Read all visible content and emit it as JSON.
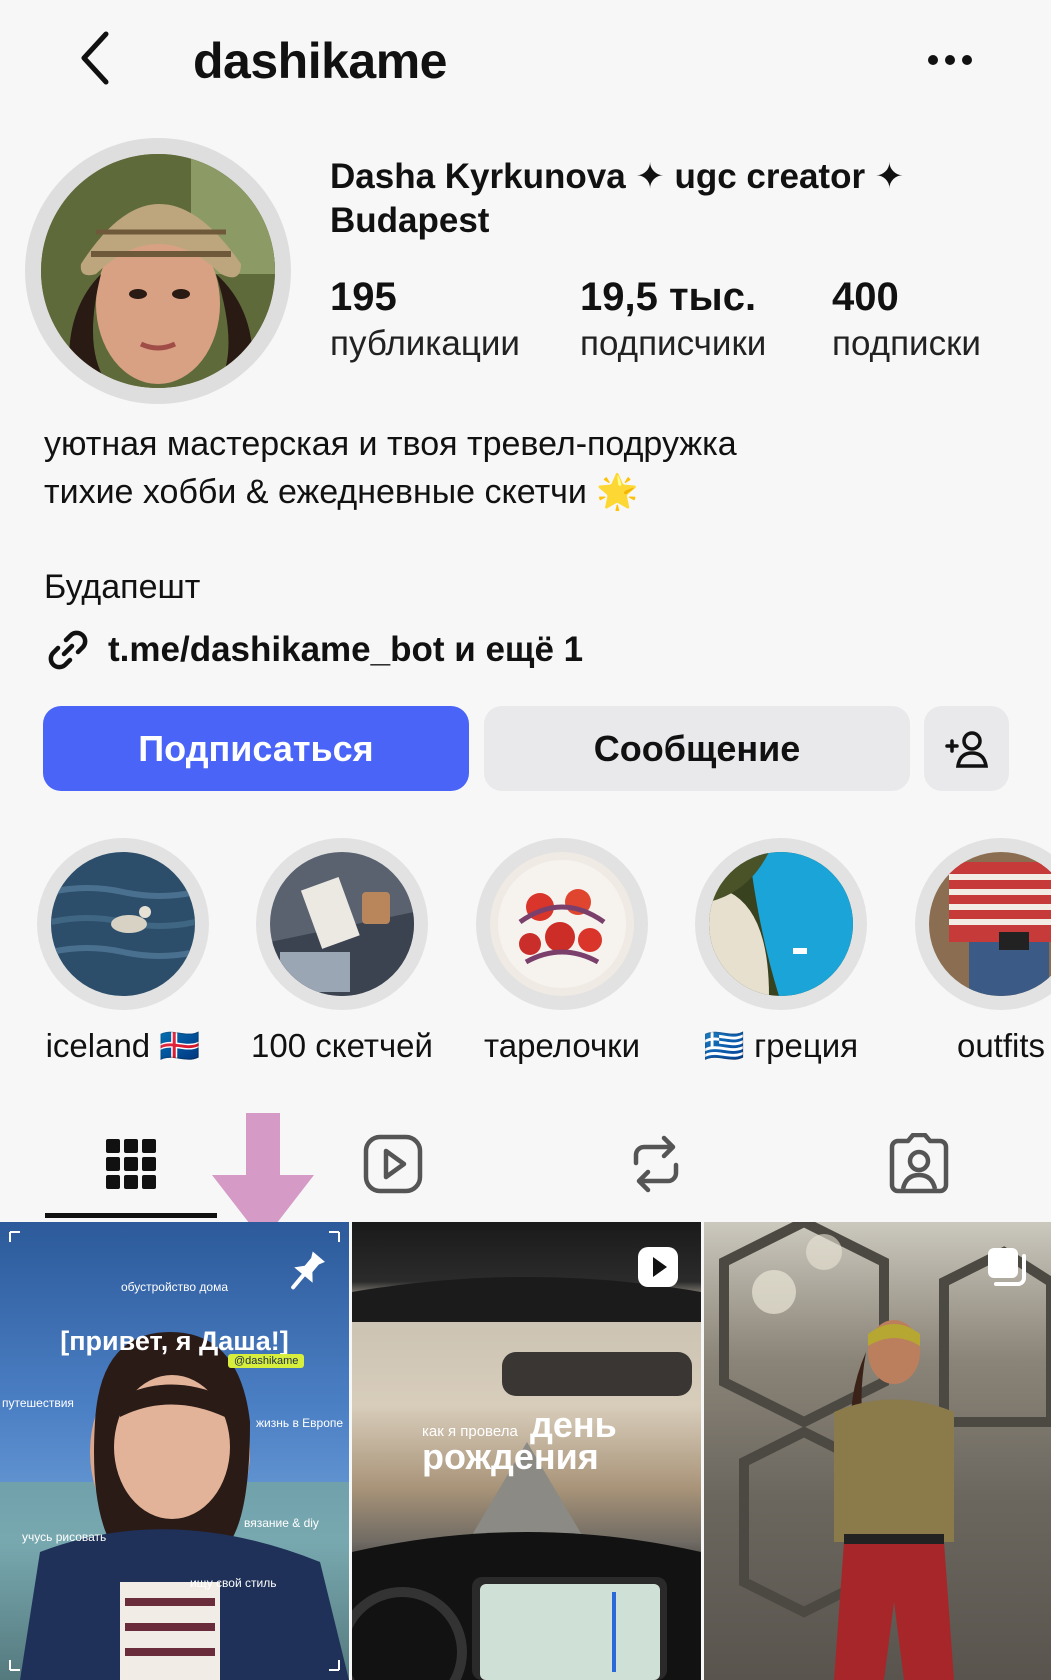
{
  "header": {
    "username": "dashikame"
  },
  "profile": {
    "display_name": "Dasha Kyrkunova ✦ ugc creator ✦ Budapest",
    "stats": [
      {
        "value": "195",
        "label": "публикации"
      },
      {
        "value": "19,5 тыс.",
        "label": "подписчики"
      },
      {
        "value": "400",
        "label": "подписки"
      }
    ],
    "bio_line1": "уютная мастерская и твоя тревел-подружка",
    "bio_line2": "тихие хобби & ежедневные скетчи",
    "bio_emoji": "🌟",
    "location": "Будапешт",
    "link": "t.me/dashikame_bot и ещё 1"
  },
  "actions": {
    "follow": "Подписаться",
    "message": "Сообщение"
  },
  "highlights": [
    {
      "label": "iceland 🇮🇸"
    },
    {
      "label": "100 скетчей"
    },
    {
      "label": "тарелочки"
    },
    {
      "label": "🇬🇷 греция"
    },
    {
      "label": "outfits"
    }
  ],
  "tabs": [
    "grid",
    "reels",
    "reposts",
    "tagged"
  ],
  "posts": [
    {
      "type": "pinned",
      "title": "[привет, я Даша!]",
      "handle": "@dashikame",
      "tags": [
        "обустройство дома",
        "путешествия",
        "жизнь в Европе",
        "вязание & diy",
        "учусь рисовать",
        "ищу свой стиль"
      ]
    },
    {
      "type": "reel",
      "text_small": "как я провела",
      "text_big1": "день",
      "text_big2": "рождения"
    },
    {
      "type": "carousel"
    }
  ],
  "colors": {
    "accent": "#4964f7",
    "arrow": "#d59ac6",
    "background": "#f7f7f7"
  }
}
